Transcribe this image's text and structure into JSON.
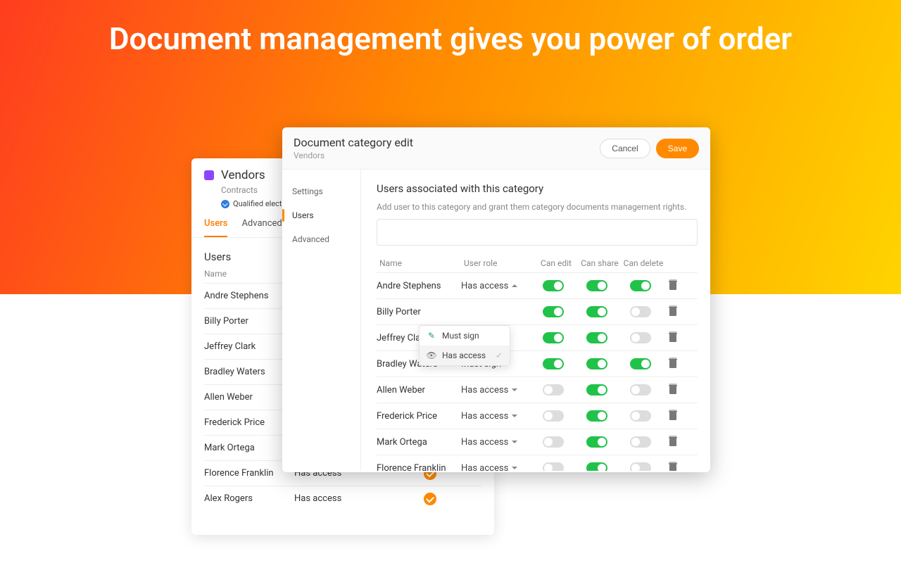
{
  "hero": {
    "title": "Document management gives you power of order"
  },
  "backPanel": {
    "title": "Vendors",
    "subtitle": "Contracts",
    "qualified": "Qualified electro",
    "tabs": [
      "Users",
      "Advanced op"
    ],
    "activeTab": 0,
    "sectionTitle": "Users",
    "colHead": "Name",
    "rows": [
      {
        "name": "Andre Stephens"
      },
      {
        "name": "Billy Porter"
      },
      {
        "name": "Jeffrey Clark"
      },
      {
        "name": "Bradley Waters"
      },
      {
        "name": "Allen Weber"
      },
      {
        "name": "Frederick Price"
      },
      {
        "name": "Mark Ortega"
      },
      {
        "name": "Florence Franklin",
        "role": "Has access",
        "check": true
      },
      {
        "name": "Alex Rogers",
        "role": "Has access",
        "check": true
      }
    ]
  },
  "modal": {
    "title": "Document category edit",
    "subtitle": "Vendors",
    "cancel": "Cancel",
    "save": "Save",
    "side": {
      "items": [
        "Settings",
        "Users",
        "Advanced"
      ],
      "active": 1
    },
    "heading": "Users associated with this category",
    "desc": "Add user to this category and grant them category documents management rights.",
    "cols": {
      "name": "Name",
      "role": "User role",
      "edit": "Can edit",
      "share": "Can share",
      "del": "Can delete"
    },
    "dropdown": {
      "opt1": "Must sign",
      "opt2": "Has access"
    },
    "rows": [
      {
        "name": "Andre Stephens",
        "role": "Has access",
        "caret": "up",
        "edit": true,
        "share": true,
        "del": true
      },
      {
        "name": "Billy Porter",
        "role": "",
        "caret": "",
        "edit": true,
        "share": true,
        "del": false
      },
      {
        "name": "Jeffrey Clark",
        "role": "Must sign",
        "caret": "down",
        "edit": true,
        "share": true,
        "del": false
      },
      {
        "name": "Bradley Waters",
        "role": "Must sign",
        "caret": "down",
        "edit": true,
        "share": true,
        "del": true
      },
      {
        "name": "Allen Weber",
        "role": "Has access",
        "caret": "down",
        "edit": false,
        "share": true,
        "del": false
      },
      {
        "name": "Frederick Price",
        "role": "Has access",
        "caret": "down",
        "edit": false,
        "share": true,
        "del": false
      },
      {
        "name": "Mark Ortega",
        "role": "Has access",
        "caret": "down",
        "edit": false,
        "share": true,
        "del": false
      },
      {
        "name": "Florence Franklin",
        "role": "Has access",
        "caret": "down",
        "edit": false,
        "share": true,
        "del": false
      }
    ]
  }
}
